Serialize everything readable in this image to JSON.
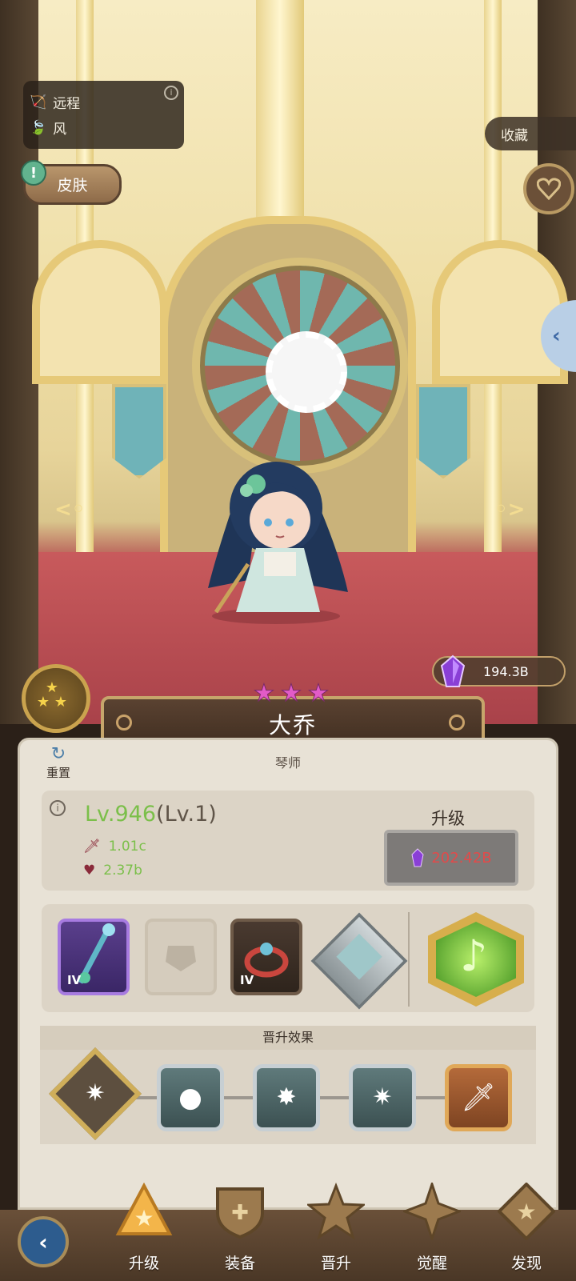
{
  "character": {
    "name": "大乔",
    "role": "琴师",
    "stars": 3,
    "attack_type": "远程",
    "element": "风"
  },
  "top": {
    "skin_label": "皮肤",
    "favorite_label": "收藏",
    "currency_amount": "194.3B"
  },
  "panel": {
    "reset_label": "重置",
    "level_main": "Lv.946",
    "level_sub": "(Lv.1)",
    "attack": "1.01c",
    "hp": "2.37b",
    "upgrade_title": "升级",
    "upgrade_cost": "202.42B",
    "equipment": [
      {
        "tier": "IV",
        "name": "staff"
      },
      {
        "tier": "",
        "name": "empty"
      },
      {
        "tier": "IV",
        "name": "ring"
      },
      {
        "tier": "",
        "name": "emblem"
      }
    ],
    "promotion_title": "晋升效果"
  },
  "tabs": [
    {
      "label": "升级"
    },
    {
      "label": "装备"
    },
    {
      "label": "晋升"
    },
    {
      "label": "觉醒"
    },
    {
      "label": "发现"
    }
  ],
  "colors": {
    "green_value": "#7bbf4a",
    "cost_red": "#e24a4a",
    "crystal_purple": "#8a3fd6"
  }
}
